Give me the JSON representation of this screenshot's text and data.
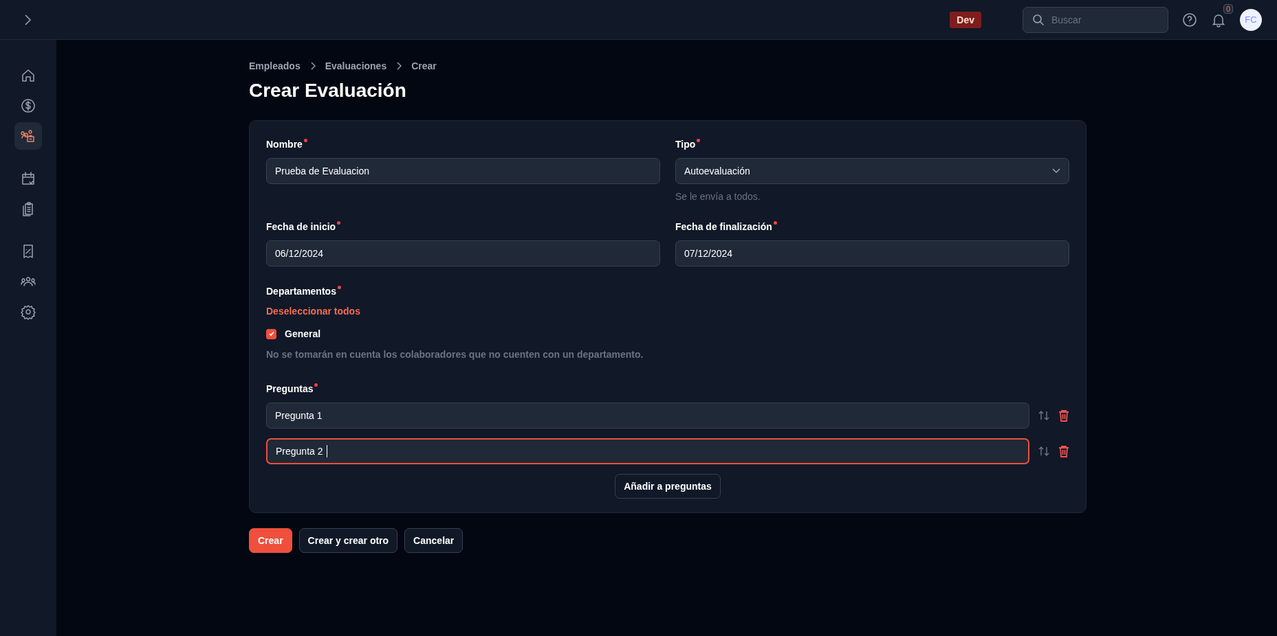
{
  "top_bar": {
    "env_badge": "Dev",
    "search": {
      "placeholder": "Buscar"
    },
    "notifications": {
      "count": "0"
    },
    "avatar": "FC"
  },
  "sidebar": {
    "groups": [
      {
        "items": [
          {
            "selected": false
          },
          {
            "selected": false
          },
          {
            "selected": true
          }
        ]
      },
      {
        "items": [
          {
            "selected": false
          },
          {
            "selected": false
          }
        ]
      },
      {
        "items": [
          {
            "selected": false
          },
          {
            "selected": false
          },
          {
            "selected": false
          }
        ]
      }
    ]
  },
  "breadcrumbs": [
    "Empleados",
    "Evaluaciones",
    "Crear"
  ],
  "title": "Crear Evaluación",
  "form": {
    "fields": [
      {
        "kind": "text",
        "label": "Nombre",
        "required": true,
        "value": "Prueba de Evaluacion"
      },
      {
        "kind": "select",
        "label": "Tipo",
        "required": true,
        "value": "Autoevaluación",
        "hint": "Se le envía a todos."
      },
      {
        "kind": "text",
        "label": "Fecha de inicio",
        "required": true,
        "value": "06/12/2024"
      },
      {
        "kind": "text",
        "label": "Fecha de finalización",
        "required": true,
        "value": "07/12/2024"
      }
    ],
    "departments": {
      "label": "Departamentos",
      "required": true,
      "toggle_link": "Deseleccionar todos",
      "options": [
        {
          "label": "General",
          "checked": true
        }
      ],
      "note": "No se tomarán en cuenta los colaboradores que no cuenten con un departamento."
    },
    "questions": {
      "label": "Preguntas",
      "required": true,
      "items": [
        {
          "value": "Pregunta 1",
          "focused": false
        },
        {
          "value": "Pregunta 2",
          "focused": true
        }
      ],
      "add_button": "Añadir a preguntas"
    }
  },
  "actions": [
    {
      "label": "Crear",
      "kind": "primary"
    },
    {
      "label": "Crear y crear otro",
      "kind": "secondary"
    },
    {
      "label": "Cancelar",
      "kind": "secondary"
    }
  ]
}
